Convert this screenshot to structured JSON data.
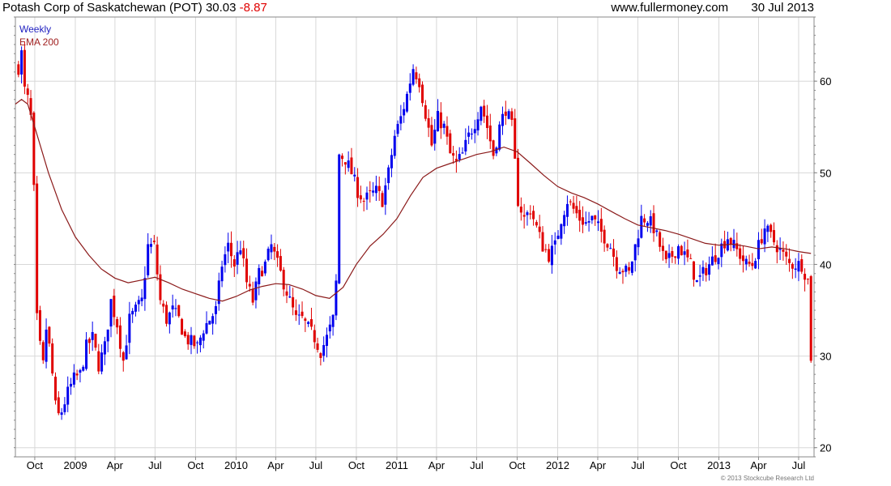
{
  "header": {
    "security": "Potash Corp of Saskatchewan (POT)",
    "price": "30.03",
    "change": "-8.87",
    "source": "www.fullermoney.com",
    "date": "30 Jul 2013"
  },
  "legend": {
    "weekly": "Weekly",
    "ema": "EMA 200",
    "weekly_color": "#2020c0",
    "ema_color": "#a02020"
  },
  "copyright": "© 2013 Stockcube Research Ltd",
  "colors": {
    "up": "#0000ee",
    "down": "#e00000",
    "ema": "#8b1a1a",
    "grid": "#d8d8d8",
    "axis": "#888888"
  },
  "chart_data": {
    "type": "candlestick",
    "interval": "weekly",
    "grid": true,
    "y_axis_side": "right",
    "ylim": [
      19,
      67
    ],
    "y_ticks": [
      20,
      30,
      40,
      50,
      60
    ],
    "x_range": [
      "2008-08-18",
      "2013-08-05"
    ],
    "x_ticks": [
      {
        "date": "2008-10-01",
        "label": "Oct"
      },
      {
        "date": "2009-01-01",
        "label": "2009"
      },
      {
        "date": "2009-04-01",
        "label": "Apr"
      },
      {
        "date": "2009-07-01",
        "label": "Jul"
      },
      {
        "date": "2009-10-01",
        "label": "Oct"
      },
      {
        "date": "2010-01-01",
        "label": "2010"
      },
      {
        "date": "2010-04-01",
        "label": "Apr"
      },
      {
        "date": "2010-07-01",
        "label": "Jul"
      },
      {
        "date": "2010-10-01",
        "label": "Oct"
      },
      {
        "date": "2011-01-01",
        "label": "2011"
      },
      {
        "date": "2011-04-01",
        "label": "Apr"
      },
      {
        "date": "2011-07-01",
        "label": "Jul"
      },
      {
        "date": "2011-10-01",
        "label": "Oct"
      },
      {
        "date": "2012-01-01",
        "label": "2012"
      },
      {
        "date": "2012-04-01",
        "label": "Apr"
      },
      {
        "date": "2012-07-01",
        "label": "Jul"
      },
      {
        "date": "2012-10-01",
        "label": "Oct"
      },
      {
        "date": "2013-01-01",
        "label": "2013"
      },
      {
        "date": "2013-04-01",
        "label": "Apr"
      },
      {
        "date": "2013-07-01",
        "label": "Jul"
      }
    ],
    "anchors": [
      [
        "2008-08-25",
        61.5
      ],
      [
        "2008-09-01",
        63
      ],
      [
        "2008-09-08",
        59
      ],
      [
        "2008-09-15",
        58
      ],
      [
        "2008-09-22",
        56
      ],
      [
        "2008-09-29",
        48
      ],
      [
        "2008-10-06",
        34
      ],
      [
        "2008-10-13",
        31
      ],
      [
        "2008-10-20",
        29
      ],
      [
        "2008-10-27",
        33
      ],
      [
        "2008-11-03",
        31
      ],
      [
        "2008-11-10",
        28
      ],
      [
        "2008-11-17",
        24.5
      ],
      [
        "2008-11-24",
        23.5
      ],
      [
        "2008-12-01",
        24
      ],
      [
        "2008-12-15",
        26
      ],
      [
        "2008-12-29",
        27.5
      ],
      [
        "2009-01-12",
        28
      ],
      [
        "2009-01-26",
        31
      ],
      [
        "2009-02-09",
        32
      ],
      [
        "2009-02-23",
        29
      ],
      [
        "2009-03-09",
        31
      ],
      [
        "2009-03-23",
        36
      ],
      [
        "2009-04-06",
        33.5
      ],
      [
        "2009-04-20",
        29.5
      ],
      [
        "2009-05-04",
        34
      ],
      [
        "2009-05-18",
        35
      ],
      [
        "2009-06-01",
        36
      ],
      [
        "2009-06-15",
        42
      ],
      [
        "2009-06-29",
        42
      ],
      [
        "2009-07-13",
        36
      ],
      [
        "2009-07-27",
        34
      ],
      [
        "2009-08-10",
        35
      ],
      [
        "2009-08-24",
        34
      ],
      [
        "2009-09-07",
        32
      ],
      [
        "2009-09-21",
        31.5
      ],
      [
        "2009-10-05",
        31
      ],
      [
        "2009-10-19",
        33
      ],
      [
        "2009-11-02",
        34
      ],
      [
        "2009-11-16",
        35
      ],
      [
        "2009-11-30",
        40
      ],
      [
        "2009-12-14",
        42
      ],
      [
        "2009-12-28",
        40
      ],
      [
        "2010-01-11",
        42
      ],
      [
        "2010-01-25",
        38
      ],
      [
        "2010-02-08",
        36
      ],
      [
        "2010-02-22",
        39
      ],
      [
        "2010-03-08",
        40
      ],
      [
        "2010-03-22",
        42
      ],
      [
        "2010-04-05",
        40
      ],
      [
        "2010-04-19",
        38
      ],
      [
        "2010-05-03",
        36
      ],
      [
        "2010-05-17",
        34
      ],
      [
        "2010-05-31",
        34
      ],
      [
        "2010-06-14",
        33
      ],
      [
        "2010-06-28",
        32
      ],
      [
        "2010-07-12",
        30.5
      ],
      [
        "2010-07-26",
        32
      ],
      [
        "2010-08-09",
        34
      ],
      [
        "2010-08-16",
        38
      ],
      [
        "2010-08-23",
        52
      ],
      [
        "2010-09-06",
        51.5
      ],
      [
        "2010-09-20",
        50
      ],
      [
        "2010-10-04",
        48
      ],
      [
        "2010-10-18",
        47
      ],
      [
        "2010-11-01",
        47.5
      ],
      [
        "2010-11-15",
        48
      ],
      [
        "2010-11-29",
        47
      ],
      [
        "2010-12-13",
        50
      ],
      [
        "2010-12-27",
        54
      ],
      [
        "2011-01-10",
        56
      ],
      [
        "2011-01-24",
        58.5
      ],
      [
        "2011-02-07",
        61.5
      ],
      [
        "2011-02-21",
        60
      ],
      [
        "2011-03-07",
        56.5
      ],
      [
        "2011-03-21",
        53
      ],
      [
        "2011-04-04",
        56
      ],
      [
        "2011-04-18",
        55
      ],
      [
        "2011-05-02",
        52
      ],
      [
        "2011-05-16",
        51
      ],
      [
        "2011-05-30",
        52
      ],
      [
        "2011-06-13",
        54
      ],
      [
        "2011-06-27",
        55.5
      ],
      [
        "2011-07-11",
        57.5
      ],
      [
        "2011-07-25",
        55
      ],
      [
        "2011-08-08",
        52
      ],
      [
        "2011-08-22",
        55
      ],
      [
        "2011-09-05",
        57
      ],
      [
        "2011-09-19",
        55
      ],
      [
        "2011-10-03",
        47
      ],
      [
        "2011-10-17",
        45
      ],
      [
        "2011-10-31",
        46
      ],
      [
        "2011-11-14",
        44
      ],
      [
        "2011-11-28",
        42
      ],
      [
        "2011-12-12",
        41
      ],
      [
        "2011-12-26",
        42
      ],
      [
        "2012-01-09",
        45
      ],
      [
        "2012-01-23",
        47
      ],
      [
        "2012-02-06",
        46
      ],
      [
        "2012-02-20",
        45
      ],
      [
        "2012-03-05",
        44.5
      ],
      [
        "2012-03-19",
        45
      ],
      [
        "2012-04-02",
        44
      ],
      [
        "2012-04-16",
        43
      ],
      [
        "2012-04-30",
        42
      ],
      [
        "2012-05-14",
        40
      ],
      [
        "2012-05-28",
        39.5
      ],
      [
        "2012-06-11",
        39
      ],
      [
        "2012-06-25",
        42
      ],
      [
        "2012-07-09",
        45
      ],
      [
        "2012-07-23",
        45
      ],
      [
        "2012-08-06",
        44
      ],
      [
        "2012-08-20",
        42
      ],
      [
        "2012-09-03",
        40
      ],
      [
        "2012-09-17",
        41
      ],
      [
        "2012-10-01",
        42
      ],
      [
        "2012-10-15",
        41
      ],
      [
        "2012-10-29",
        40
      ],
      [
        "2012-11-12",
        38
      ],
      [
        "2012-11-26",
        39
      ],
      [
        "2012-12-10",
        40
      ],
      [
        "2012-12-24",
        41
      ],
      [
        "2013-01-07",
        42
      ],
      [
        "2013-01-21",
        43
      ],
      [
        "2013-02-04",
        42
      ],
      [
        "2013-02-18",
        41
      ],
      [
        "2013-03-04",
        40
      ],
      [
        "2013-03-18",
        40
      ],
      [
        "2013-04-01",
        42
      ],
      [
        "2013-04-15",
        44
      ],
      [
        "2013-04-29",
        43
      ],
      [
        "2013-05-13",
        42
      ],
      [
        "2013-05-27",
        41
      ],
      [
        "2013-06-10",
        40
      ],
      [
        "2013-06-24",
        40
      ],
      [
        "2013-07-08",
        40
      ],
      [
        "2013-07-22",
        38.2
      ],
      [
        "2013-07-29",
        30.03
      ]
    ],
    "ema200": [
      [
        "2008-08-18",
        57.5
      ],
      [
        "2008-09-01",
        58
      ],
      [
        "2008-09-15",
        57.5
      ],
      [
        "2008-10-01",
        55
      ],
      [
        "2008-11-01",
        50
      ],
      [
        "2008-12-01",
        46
      ],
      [
        "2009-01-01",
        43
      ],
      [
        "2009-02-01",
        41
      ],
      [
        "2009-03-01",
        39.5
      ],
      [
        "2009-04-01",
        38.5
      ],
      [
        "2009-05-01",
        38
      ],
      [
        "2009-06-01",
        38.3
      ],
      [
        "2009-07-01",
        38.6
      ],
      [
        "2009-08-01",
        38
      ],
      [
        "2009-09-01",
        37.3
      ],
      [
        "2009-10-01",
        36.8
      ],
      [
        "2009-11-01",
        36.3
      ],
      [
        "2009-12-01",
        36
      ],
      [
        "2010-01-01",
        36.5
      ],
      [
        "2010-02-01",
        37.2
      ],
      [
        "2010-03-01",
        37.6
      ],
      [
        "2010-04-01",
        37.9
      ],
      [
        "2010-05-01",
        37.8
      ],
      [
        "2010-06-01",
        37.3
      ],
      [
        "2010-07-01",
        36.6
      ],
      [
        "2010-08-01",
        36.3
      ],
      [
        "2010-09-01",
        37.5
      ],
      [
        "2010-10-01",
        40
      ],
      [
        "2010-11-01",
        42
      ],
      [
        "2010-12-01",
        43.3
      ],
      [
        "2011-01-01",
        45
      ],
      [
        "2011-02-01",
        47.5
      ],
      [
        "2011-03-01",
        49.5
      ],
      [
        "2011-04-01",
        50.5
      ],
      [
        "2011-05-01",
        51
      ],
      [
        "2011-06-01",
        51.5
      ],
      [
        "2011-07-01",
        52
      ],
      [
        "2011-08-01",
        52.3
      ],
      [
        "2011-09-01",
        52.8
      ],
      [
        "2011-10-01",
        52.3
      ],
      [
        "2011-11-01",
        51
      ],
      [
        "2011-12-01",
        49.7
      ],
      [
        "2012-01-01",
        48.5
      ],
      [
        "2012-02-01",
        47.8
      ],
      [
        "2012-03-01",
        47.3
      ],
      [
        "2012-04-01",
        46.6
      ],
      [
        "2012-05-01",
        45.8
      ],
      [
        "2012-06-01",
        45
      ],
      [
        "2012-07-01",
        44.3
      ],
      [
        "2012-08-01",
        44
      ],
      [
        "2012-09-01",
        43.7
      ],
      [
        "2012-10-01",
        43.3
      ],
      [
        "2012-11-01",
        42.8
      ],
      [
        "2012-12-01",
        42.3
      ],
      [
        "2013-01-01",
        42.1
      ],
      [
        "2013-02-01",
        42.2
      ],
      [
        "2013-03-01",
        42
      ],
      [
        "2013-04-01",
        41.7
      ],
      [
        "2013-05-01",
        41.9
      ],
      [
        "2013-06-01",
        41.7
      ],
      [
        "2013-07-01",
        41.4
      ],
      [
        "2013-07-29",
        41.2
      ]
    ]
  }
}
